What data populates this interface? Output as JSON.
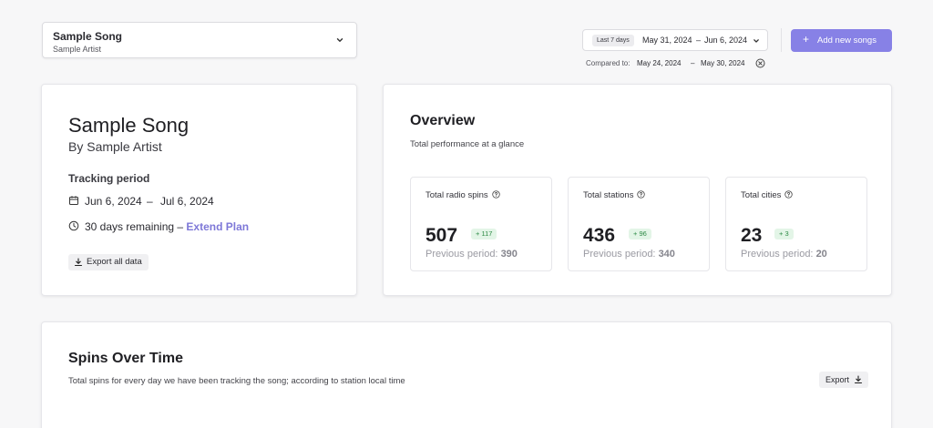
{
  "song_select": {
    "title": "Sample Song",
    "artist": "Sample Artist"
  },
  "date_range": {
    "preset": "Last 7 days",
    "start": "May 31, 2024",
    "end": "Jun 6, 2024",
    "separator": "–"
  },
  "add_button": {
    "label": "Add new songs"
  },
  "compare": {
    "label": "Compared to:",
    "start": "May 24, 2024",
    "separator": "–",
    "end": "May 30, 2024"
  },
  "song_card": {
    "name": "Sample Song",
    "by": "By Sample Artist",
    "tracking_heading": "Tracking period",
    "period_start": "Jun 6, 2024",
    "period_separator": "–",
    "period_end": "Jul 6, 2024",
    "remaining": "30 days remaining – ",
    "extend_label": "Extend Plan",
    "export_all_label": "Export all data"
  },
  "overview": {
    "title": "Overview",
    "subtitle": "Total performance at a glance",
    "stats": [
      {
        "label": "Total radio spins",
        "value": "507",
        "delta": "+ 117",
        "prev_label": "Previous period:",
        "prev_value": "390"
      },
      {
        "label": "Total stations",
        "value": "436",
        "delta": "+ 96",
        "prev_label": "Previous period:",
        "prev_value": "340"
      },
      {
        "label": "Total cities",
        "value": "23",
        "delta": "+ 3",
        "prev_label": "Previous period:",
        "prev_value": "20"
      }
    ]
  },
  "spins": {
    "title": "Spins Over Time",
    "subtitle": "Total spins for every day we have been tracking the song; according to station local time",
    "export_label": "Export"
  },
  "colors": {
    "accent": "#8781e6",
    "link": "#7e78d8",
    "positive_bg": "#e3f5e7",
    "positive_text": "#2e8a46",
    "background": "#f7f7f8"
  },
  "icons": {
    "song_select": "chevron-down-icon",
    "date_range": "chevron-down-icon",
    "add": "plus-icon",
    "compare_clear": "close-circle-icon",
    "period": "calendar-icon",
    "remaining": "clock-icon",
    "download": "download-icon",
    "help": "help-circle-icon"
  }
}
